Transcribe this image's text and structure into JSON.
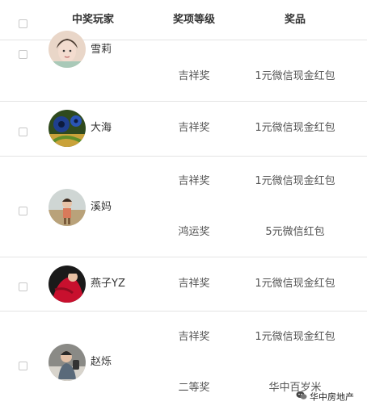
{
  "header": {
    "player_label": "中奖玩家",
    "level_label": "奖项等级",
    "prize_label": "奖品"
  },
  "winners": [
    {
      "name": "雪莉",
      "avatar": "portrait-girl-photo",
      "prizes": [
        {
          "level": "吉祥奖",
          "prize": "1元微信现金红包"
        }
      ]
    },
    {
      "name": "大海",
      "avatar": "blue-flower-painting",
      "prizes": [
        {
          "level": "吉祥奖",
          "prize": "1元微信现金红包"
        }
      ]
    },
    {
      "name": "溪妈",
      "avatar": "child-outdoor-photo",
      "prizes": [
        {
          "level": "吉祥奖",
          "prize": "1元微信现金红包"
        },
        {
          "level": "鸿运奖",
          "prize": "5元微信红包"
        }
      ]
    },
    {
      "name": "燕子YZ",
      "avatar": "red-dress-photo",
      "prizes": [
        {
          "level": "吉祥奖",
          "prize": "1元微信现金红包"
        }
      ]
    },
    {
      "name": "赵烁",
      "avatar": "person-selfie-photo",
      "prizes": [
        {
          "level": "吉祥奖",
          "prize": "1元微信现金红包"
        },
        {
          "level": "二等奖",
          "prize": "华中百岁米"
        }
      ]
    }
  ],
  "watermark": {
    "text": "华中房地产",
    "icon": "wechat-icon"
  },
  "colors": {
    "divider": "#e4e4e4",
    "header_text": "#333333",
    "cell_text": "#555555"
  }
}
